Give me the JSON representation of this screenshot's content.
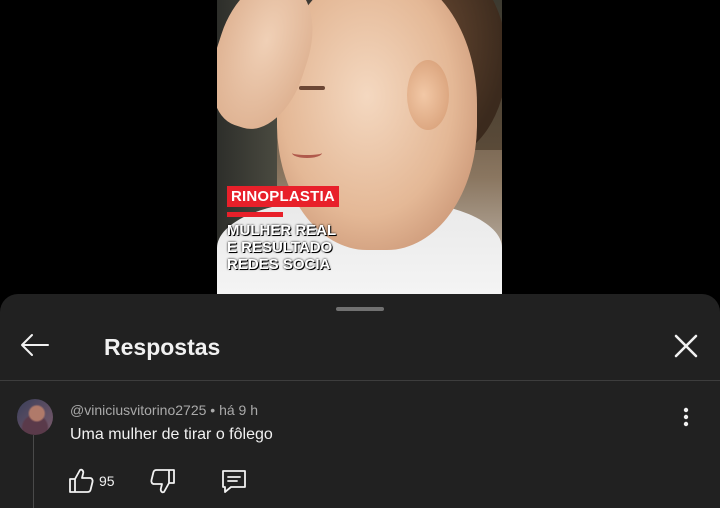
{
  "video": {
    "caption_tag": "RINOPLASTIA",
    "caption_lines": [
      "MULHER REAL",
      "E RESULTADO",
      "REDES SOCIA"
    ]
  },
  "sheet": {
    "title": "Respostas",
    "icons": {
      "back": "arrow-left-icon",
      "close": "close-icon",
      "more": "more-vertical-icon",
      "like": "thumbs-up-icon",
      "dislike": "thumbs-down-icon",
      "reply": "comment-reply-icon"
    }
  },
  "comment": {
    "meta": "@viniciusvitorino2725 • há 9 h",
    "text": "Uma mulher de tirar o fôlego",
    "like_count": "95"
  },
  "colors": {
    "sheet_bg": "#212121",
    "caption_red": "#e8202a",
    "text_primary": "#f1f1f1",
    "text_secondary": "#aaaaaa"
  }
}
